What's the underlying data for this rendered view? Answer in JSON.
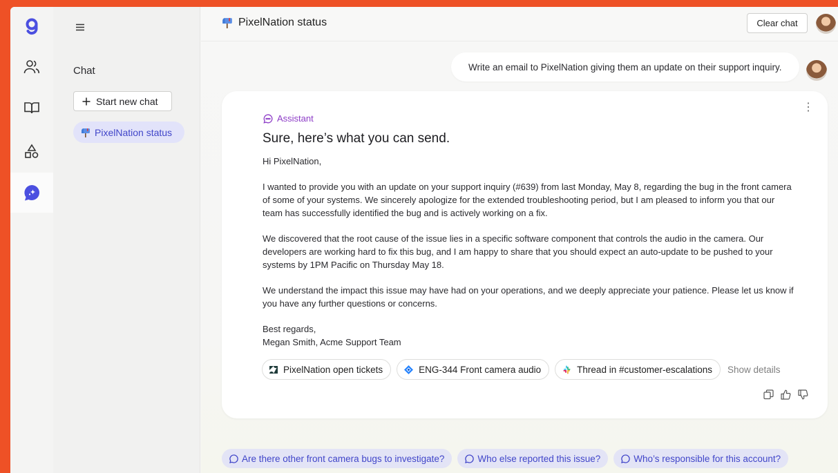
{
  "colors": {
    "brand": "#ee5126",
    "accent": "#4146c9",
    "assistant": "#8d3cc7"
  },
  "rail": {
    "items": [
      {
        "name": "logo-icon"
      },
      {
        "name": "people-icon"
      },
      {
        "name": "book-icon"
      },
      {
        "name": "shapes-icon"
      },
      {
        "name": "chat-spark-icon"
      }
    ]
  },
  "sidebar": {
    "menu_icon": "hamburger-icon",
    "title": "Chat",
    "new_chat_label": "Start new chat",
    "items": [
      {
        "label": "PixelNation status",
        "icon": "mailbox-icon"
      }
    ]
  },
  "header": {
    "title": "PixelNation status",
    "icon": "mailbox-icon",
    "clear_label": "Clear chat"
  },
  "conversation": {
    "user_message": "Write an email to PixelNation giving them an update on their support inquiry.",
    "assistant_label": "Assistant",
    "headline": "Sure, here’s what you can send.",
    "greeting": "Hi PixelNation,",
    "paragraphs": [
      "I wanted to provide you with an update on your support inquiry (#639) from last Monday, May 8, regarding the bug in the front camera of some of your systems. We sincerely apologize for the extended troubleshooting period, but I am pleased to inform you that our team has successfully identified the bug and is actively working on a fix.",
      "We discovered that the root cause of the issue lies in a specific software component that controls the audio in the camera. Our developers are working hard to fix this bug, and I am happy to share that you should expect an auto-update to be pushed to your systems by 1PM Pacific on Thursday May 18.",
      "We understand the impact this issue may have had on your operations, and we deeply appreciate your patience. Please let us know if you have any further questions or concerns."
    ],
    "signoff": "Best regards,",
    "signature": "Megan Smith, Acme Support Team",
    "sources": [
      {
        "label": "PixelNation open tickets",
        "icon": "zendesk-icon"
      },
      {
        "label": "ENG-344 Front camera audio",
        "icon": "jira-icon"
      },
      {
        "label": "Thread in #customer-escalations",
        "icon": "slack-icon"
      }
    ],
    "show_details": "Show details"
  },
  "suggestions": [
    "Are there other front camera bugs to investigate?",
    "Who else reported this issue?",
    "Who’s responsible for this account?"
  ]
}
